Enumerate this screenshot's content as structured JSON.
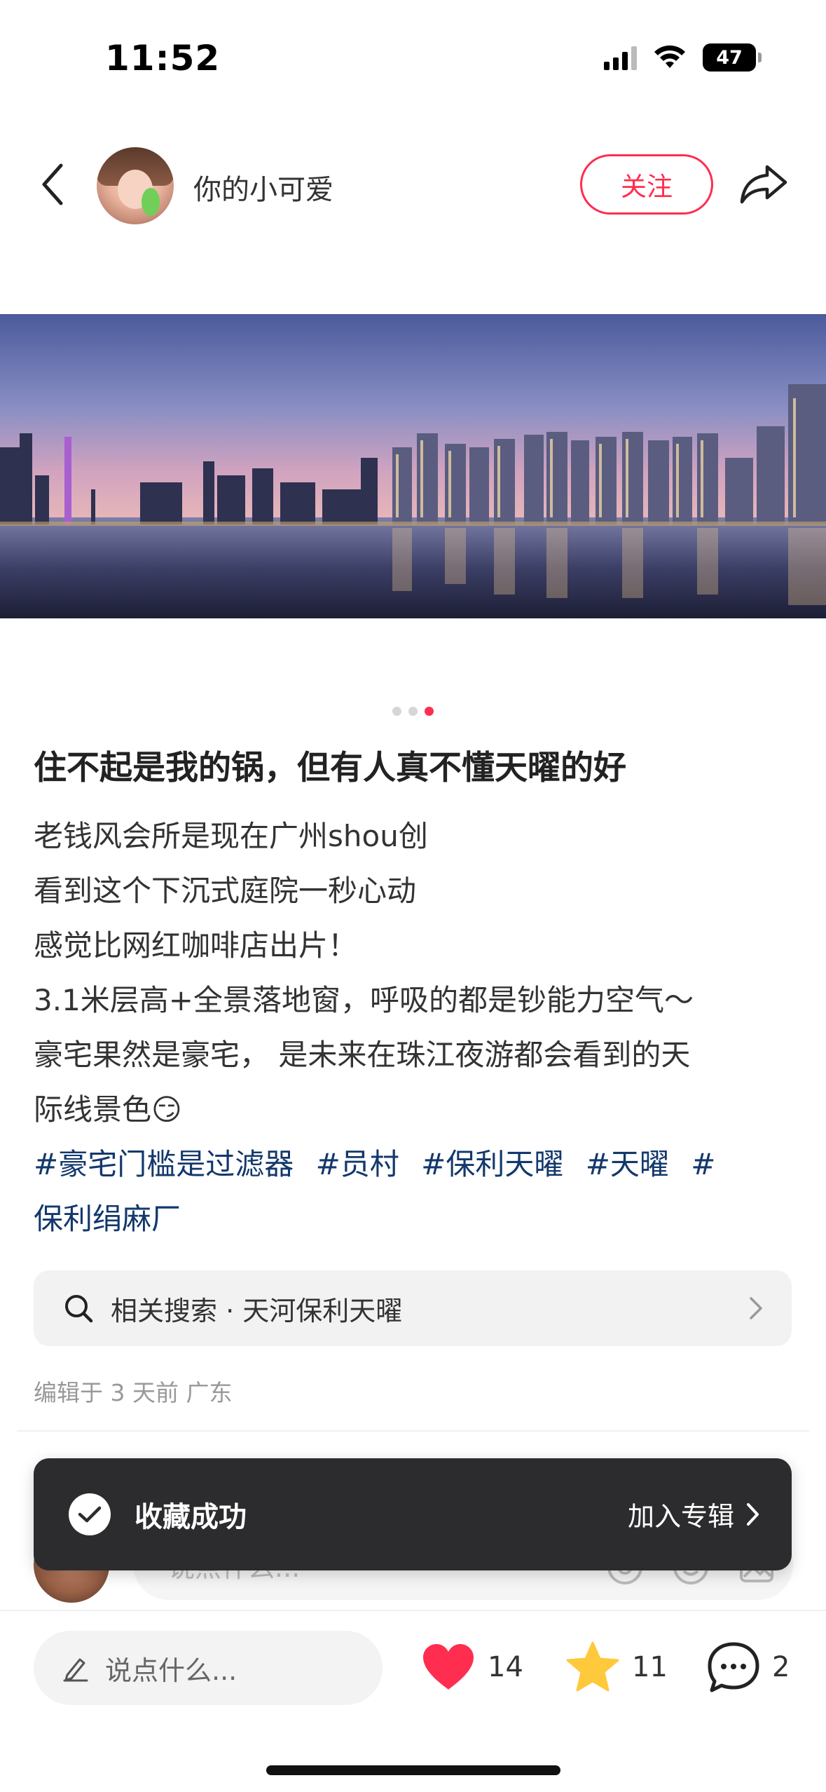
{
  "status_bar": {
    "time": "11:52",
    "battery": "47",
    "icons": [
      "signal-icon",
      "wifi-icon",
      "battery-icon"
    ]
  },
  "header": {
    "back_icon": "chevron-left-icon",
    "username": "你的小可爱",
    "follow_label": "关注",
    "share_icon": "share-icon",
    "accent_color": "#ff2d4f"
  },
  "carousel": {
    "total": 3,
    "active_index": 3
  },
  "post": {
    "title": "住不起是我的锅，但有人真不懂天曜的好",
    "lines": [
      "老钱风会所是现在广州shou创",
      "看到这个下沉式庭院一秒心动",
      "感觉比网红咖啡店出片！",
      "3.1米层高+全景落地窗，呼吸的都是钞能力空气～",
      "豪宅果然是豪宅， 是未来在珠江夜游都会看到的天",
      "际线景色😏"
    ],
    "tags": [
      "#豪宅门槛是过滤器",
      "#员村",
      "#保利天曜",
      "#天曜",
      "#",
      "保利绢麻厂"
    ],
    "tag_color": "#13386c"
  },
  "related_search": {
    "label": "相关搜索 · 天河保利天曜"
  },
  "meta": {
    "edited": "编辑于 3 天前 广东"
  },
  "comment_bar": {
    "placeholder": "说点什么...",
    "tools": [
      "at-icon",
      "emoji-icon",
      "image-icon"
    ]
  },
  "toast": {
    "message": "收藏成功",
    "action_label": "加入专辑"
  },
  "bottom_bar": {
    "placeholder": "说点什么...",
    "likes": "14",
    "favorites": "11",
    "comments": "2",
    "like_color": "#ff2d4f",
    "favorite_color": "#ffc93c"
  }
}
